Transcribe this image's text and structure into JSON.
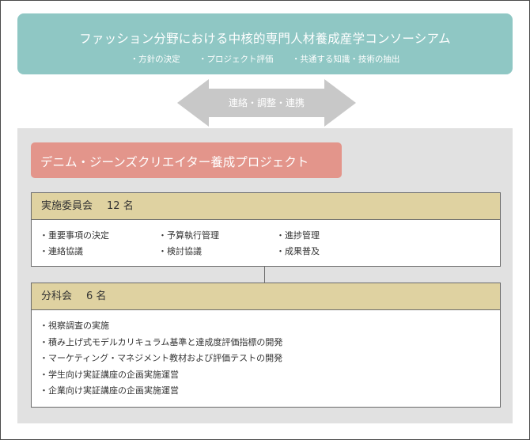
{
  "consortium": {
    "title": "ファッション分野における中核的専門人材養成産学コンソーシアム",
    "points": [
      "・方針の決定",
      "・プロジェクト評価",
      "・共通する知識・技術の抽出"
    ]
  },
  "arrow": {
    "label": "連絡・調整・連携"
  },
  "project": {
    "title": "デニム・ジーンズクリエイター養成プロジェクト"
  },
  "executive_committee": {
    "name": "実施委員会",
    "count": "12 名",
    "items": [
      "・重要事項の決定",
      "・予算執行管理",
      "・進捗管理",
      "・連絡協議",
      "・検討協議",
      "・成果普及"
    ]
  },
  "subcommittee": {
    "name": "分科会",
    "count": "6 名",
    "items": [
      "・視察調査の実施",
      "・積み上げ式モデルカリキュラム基準と達成度評価指標の開発",
      "・マーケティング・マネジメント教材および評価テストの開発",
      "・学生向け実証講座の企画実施運営",
      "・企業向け実証講座の企画実施運営"
    ]
  },
  "colors": {
    "consortium": "#8fc7c4",
    "arrow": "#c8c8c8",
    "panel": "#e1e1e1",
    "project_title": "#e3958b",
    "committee_header": "#dfd2a1"
  }
}
